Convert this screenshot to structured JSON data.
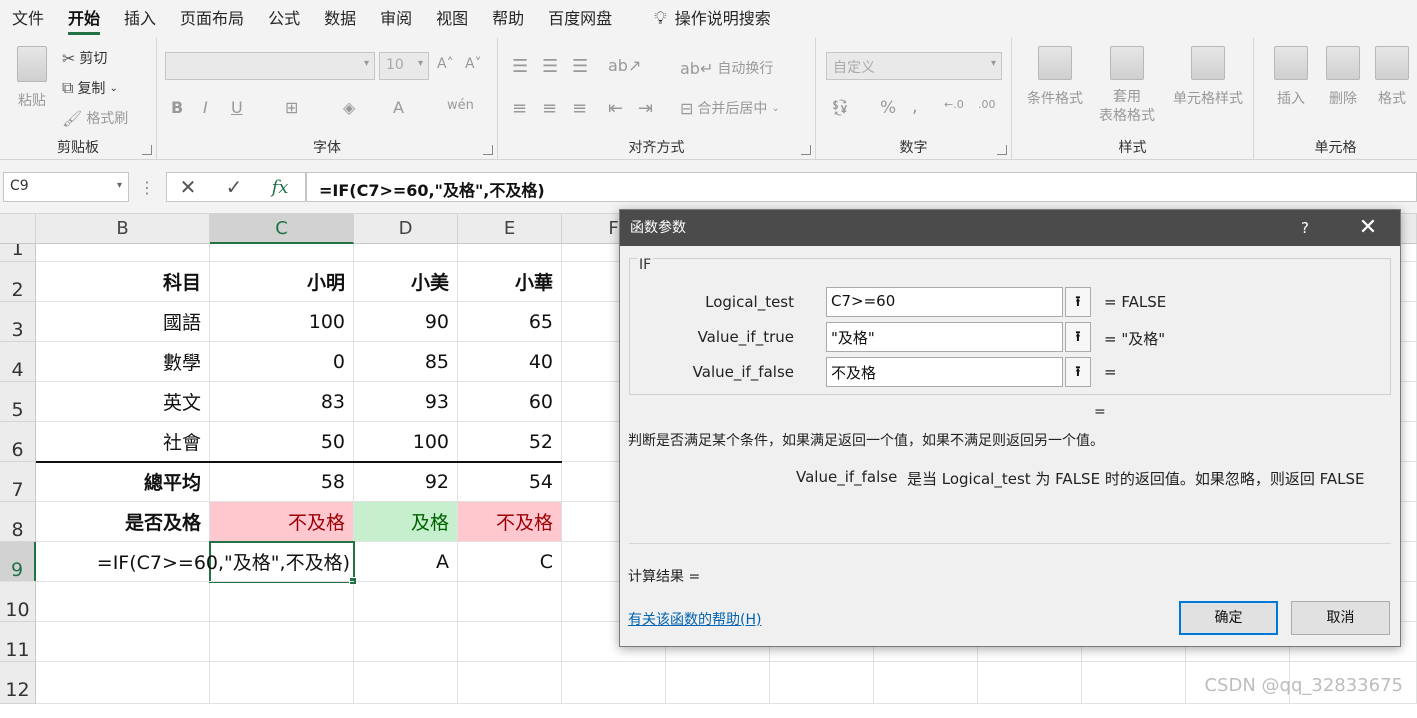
{
  "menu": [
    "文件",
    "开始",
    "插入",
    "页面布局",
    "公式",
    "数据",
    "审阅",
    "视图",
    "帮助",
    "百度网盘"
  ],
  "menu_active": "开始",
  "tell_me": "操作说明搜索",
  "ribbon": {
    "clipboard": {
      "label": "剪贴板",
      "paste": "粘贴",
      "cut": "剪切",
      "copy": "复制",
      "format_painter": "格式刷"
    },
    "font": {
      "label": "字体",
      "size": "10"
    },
    "align": {
      "label": "对齐方式",
      "wrap": "自动换行",
      "merge": "合并后居中"
    },
    "number": {
      "label": "数字",
      "format": "自定义"
    },
    "styles": {
      "label": "样式",
      "cond": "条件格式",
      "table": "套用\n表格格式",
      "cell": "单元格样式"
    },
    "cells": {
      "label": "单元格",
      "insert": "插入",
      "delete": "删除",
      "format": "格式"
    }
  },
  "namebox": "C9",
  "formula": "=IF(C7>=60,\"及格\",不及格)",
  "columns": [
    "B",
    "C",
    "D",
    "E",
    "F"
  ],
  "rows": [
    "1",
    "2",
    "3",
    "4",
    "5",
    "6",
    "7",
    "8",
    "9",
    "10",
    "11",
    "12"
  ],
  "table": {
    "r2": [
      "科目",
      "小明",
      "小美",
      "小華"
    ],
    "r3": [
      "國語",
      "100",
      "90",
      "65"
    ],
    "r4": [
      "數學",
      "0",
      "85",
      "40"
    ],
    "r5": [
      "英文",
      "83",
      "93",
      "60"
    ],
    "r6": [
      "社會",
      "50",
      "100",
      "52"
    ],
    "r7": [
      "總平均",
      "58",
      "92",
      "54"
    ],
    "r8": [
      "是否及格",
      "不及格",
      "及格",
      "不及格"
    ],
    "r9": [
      "=IF(C7>=60,\"及格\",不及格)",
      "",
      "A",
      "C"
    ]
  },
  "dialog": {
    "title": "函数参数",
    "help_icon": "?",
    "close_icon": "✕",
    "function": "IF",
    "args": [
      {
        "label": "Logical_test",
        "value": "C7>=60",
        "result": "=  FALSE"
      },
      {
        "label": "Value_if_true",
        "value": "\"及格\"",
        "result": "=  \"及格\""
      },
      {
        "label": "Value_if_false",
        "value": "不及格",
        "result": "="
      }
    ],
    "overall_eq": "=",
    "description": "判断是否满足某个条件，如果满足返回一个值，如果不满足则返回另一个值。",
    "arg_name": "Value_if_false",
    "arg_desc": "是当 Logical_test 为 FALSE 时的返回值。如果忽略，则返回 FALSE",
    "calc_result": "计算结果 =",
    "help_link": "有关该函数的帮助(H)",
    "ok": "确定",
    "cancel": "取消"
  },
  "watermark": "CSDN @qq_32833675"
}
